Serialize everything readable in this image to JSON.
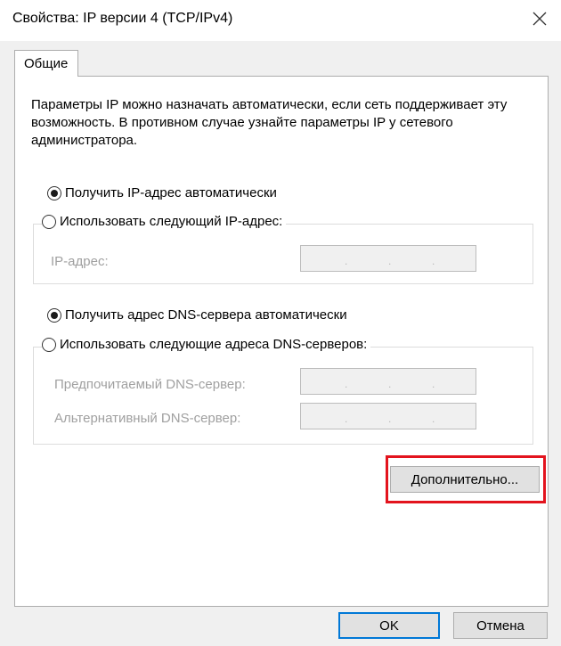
{
  "window": {
    "title": "Свойства: IP версии 4 (TCP/IPv4)",
    "close_icon": "close-icon"
  },
  "tabs": [
    {
      "label": "Общие",
      "selected": true
    }
  ],
  "general": {
    "description": "Параметры IP можно назначать автоматически, если сеть поддерживает эту возможность. В противном случае узнайте параметры IP у сетевого администратора.",
    "ip_auto_label": "Получить IP-адрес автоматически",
    "ip_auto_selected": true,
    "ip_manual_label": "Использовать следующий IP-адрес:",
    "ip_manual_selected": false,
    "ip_address_label": "IP-адрес:",
    "dns_auto_label": "Получить адрес DNS-сервера автоматически",
    "dns_auto_selected": true,
    "dns_manual_label": "Использовать следующие адреса DNS-серверов:",
    "dns_manual_selected": false,
    "preferred_dns_label": "Предпочитаемый DNS-сервер:",
    "alternate_dns_label": "Альтернативный DNS-сервер:",
    "advanced_button": "Дополнительно..."
  },
  "footer": {
    "ok_button": "OK",
    "cancel_button": "Отмена"
  },
  "colors": {
    "highlight": "#e3141e",
    "primary_border": "#0078d7",
    "disabled_text": "#a0a0a0"
  }
}
